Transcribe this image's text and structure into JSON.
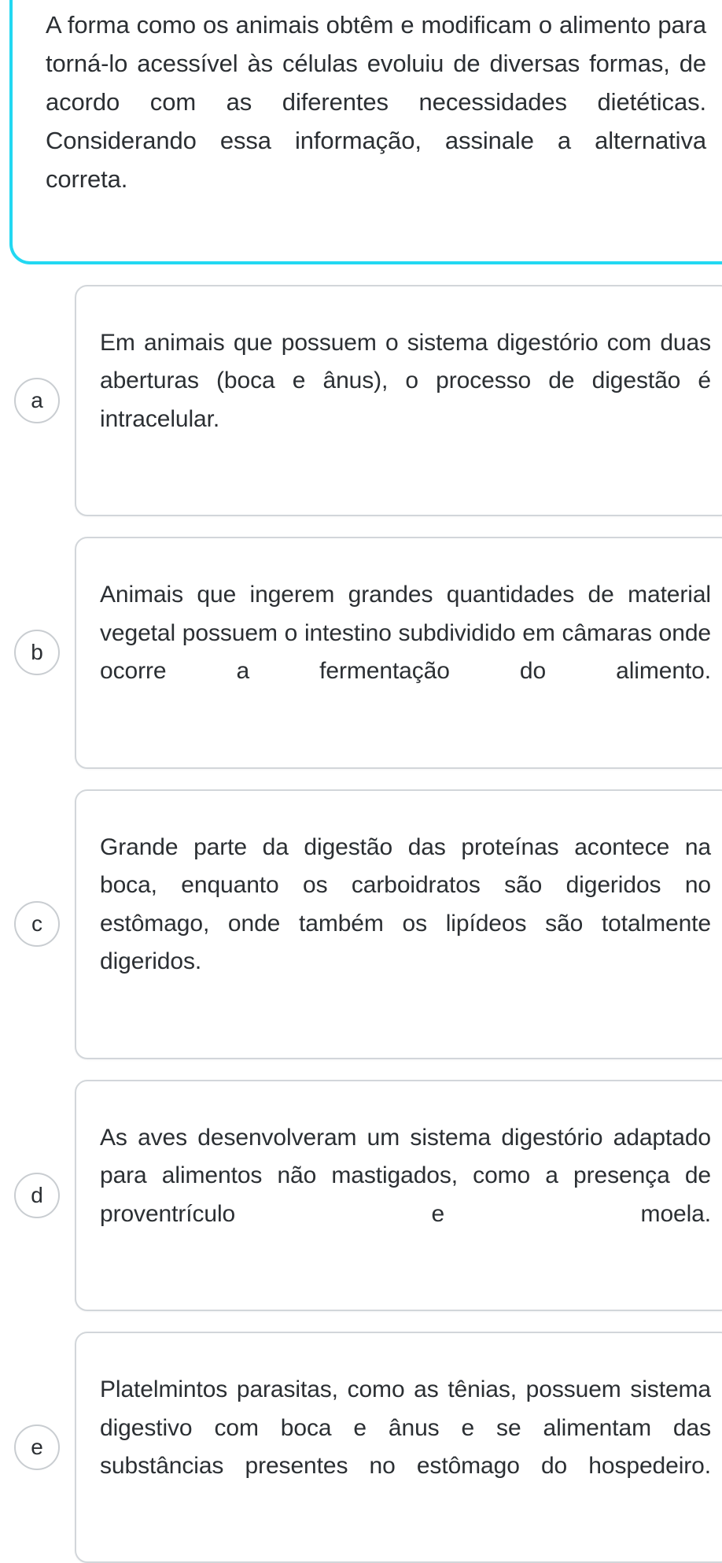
{
  "colors": {
    "accent": "#22d8f2",
    "text": "#2b2f33",
    "card_border": "#d2d6da",
    "circle_border": "#c9cdd1",
    "background": "#ffffff"
  },
  "question": {
    "statement": "A forma como os animais obtêm e modificam o alimento para torná-lo acessível às células evoluiu de diversas formas, de acordo com as diferentes necessidades dietéticas. Considerando essa informação, assinale a alternativa correta."
  },
  "options": [
    {
      "letter": "a",
      "text": "Em animais que possuem o sistema digestório com duas aberturas (boca e ânus), o processo de digestão é intracelular."
    },
    {
      "letter": "b",
      "text": "Animais que ingerem grandes quantidades de material vegetal possuem o intestino subdividido em câmaras onde ocorre a fermentação do alimento."
    },
    {
      "letter": "c",
      "text": "Grande parte da digestão das proteínas acontece na boca, enquanto os carboidratos são digeridos no estômago, onde também os lipídeos são totalmente digeridos."
    },
    {
      "letter": "d",
      "text": "As aves desenvolveram um sistema digestório adaptado para alimentos não mastigados, como a presença de proventrículo e moela."
    },
    {
      "letter": "e",
      "text": "Platelmintos parasitas, como as tênias, possuem sistema digestivo com boca e ânus e se alimentam das substâncias presentes no estômago do hospedeiro."
    }
  ]
}
